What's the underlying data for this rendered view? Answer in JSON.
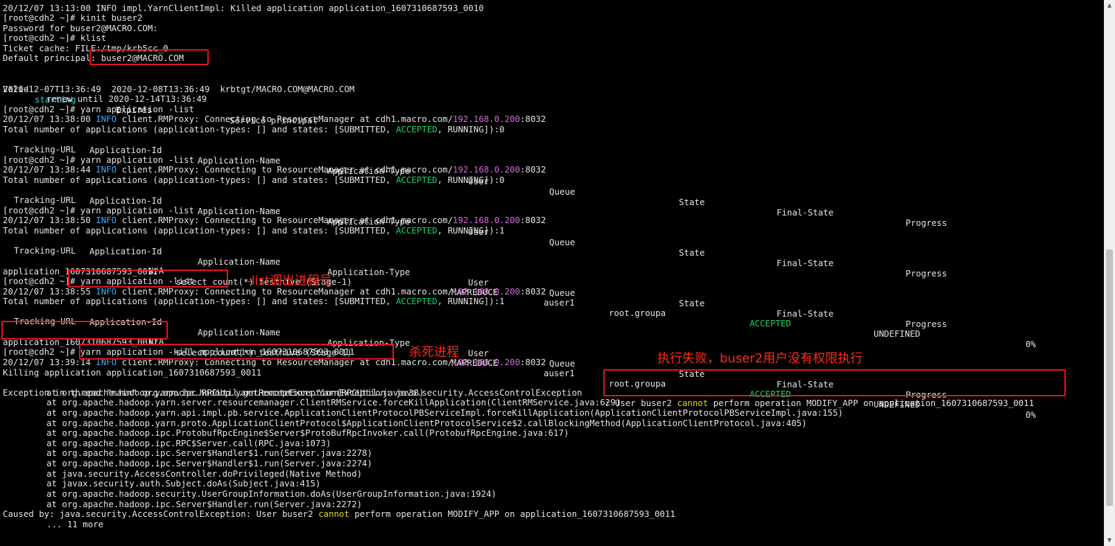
{
  "terminal": {
    "prompt": "[root@cdh2 ~]#",
    "kill_info_line": "20/12/07 13:13:00 INFO impl.YarnClientImpl: Killed application application_1607310687593_0010",
    "cmd_kinit": "kinit buser2",
    "password_prompt": "Password for buser2@MACRO.COM:",
    "cmd_klist": "klist",
    "ticket_cache": "Ticket cache: FILE:/tmp/krb5cc_0",
    "default_principal": "Default principal: buser2@MACRO.COM",
    "klist_header": {
      "valid": "Valid",
      "starting": "starting",
      "expires": "Expires",
      "service": "Service principal"
    },
    "ticket_row": "2020-12-07T13:36:49  2020-12-08T13:36:49  krbtgt/MACRO.COM@MACRO.COM",
    "renew_until": "renew until 2020-12-14T13:36:49",
    "cmd_list": "yarn application -list",
    "rmproxy": {
      "info": "INFO",
      "msg": "client.RMProxy: Connecting to ResourceManager at cdh1.macro.com/",
      "ip": "192.168.0.200",
      "port": ":8032",
      "times": [
        "20/12/07 13:38:00",
        "20/12/07 13:38:44",
        "20/12/07 13:38:50",
        "20/12/07 13:38:55",
        "20/12/07 13:39:14"
      ]
    },
    "total_apps": {
      "prefix": "Total number of applications (application-types: [] and states: [SUBMITTED,",
      "accepted": "ACCEPTED",
      "suffix_0": ", RUNNING]):0",
      "suffix_1": ", RUNNING]):1"
    },
    "columns": [
      "Application-Id",
      "Application-Name",
      "Application-Type",
      "User",
      "Queue",
      "State",
      "Final-State",
      "Progress",
      "Tracking-URL"
    ],
    "app_row": {
      "id": "application_1607310687593_0011",
      "name": "select count(*) testhive (Stage-1)",
      "type": "MAPREDUCE",
      "user": "auser1",
      "queue": "root.groupa",
      "state": "ACCEPTED",
      "final_state": "UNDEFINED",
      "progress": "0%",
      "tracking_url": "N/A"
    },
    "cmd_kill": "yarn application -kill application_1607310687593_0011",
    "killing": "Killing application application_1607310687593_0011",
    "exception_prefix": "Exception in thread \"main\" org.apache.hadoop.yarn.exceptions.YarnException: java.security.AccessControlException",
    "exception_tail": {
      "pre": ": User buser2 ",
      "cannot": "cannot",
      "post": " perform operation MODIFY_APP on application_1607310687593_0011"
    },
    "stack": [
      "at org.apache.hadoop.yarn.ipc.RPCUtil.getRemoteException(RPCUtil.java:38)",
      "at org.apache.hadoop.yarn.server.resourcemanager.ClientRMService.forceKillApplication(ClientRMService.java:629)",
      "at org.apache.hadoop.yarn.api.impl.pb.service.ApplicationClientProtocolPBServiceImpl.forceKillApplication(ApplicationClientProtocolPBServiceImpl.java:155)",
      "at org.apache.hadoop.yarn.proto.ApplicationClientProtocol$ApplicationClientProtocolService$2.callBlockingMethod(ApplicationClientProtocol.java:405)",
      "at org.apache.hadoop.ipc.ProtobufRpcEngine$Server$ProtoBufRpcInvoker.call(ProtobufRpcEngine.java:617)",
      "at org.apache.hadoop.ipc.RPC$Server.call(RPC.java:1073)",
      "at org.apache.hadoop.ipc.Server$Handler$1.run(Server.java:2278)",
      "at org.apache.hadoop.ipc.Server$Handler$1.run(Server.java:2274)",
      "at java.security.AccessController.doPrivileged(Native Method)",
      "at javax.security.auth.Subject.doAs(Subject.java:415)",
      "at org.apache.hadoop.security.UserGroupInformation.doAs(UserGroupInformation.java:1924)",
      "at org.apache.hadoop.ipc.Server$Handler.run(Server.java:2272)"
    ],
    "caused_by": {
      "pre": "Caused by: java.security.AccessControlException: User buser2 ",
      "cannot": "cannot",
      "post": " perform operation MODIFY_APP on application_1607310687593_0011"
    },
    "more": "... 11 more"
  },
  "annotations": {
    "list_note": "-list调出进程号",
    "kill_note": "杀死进程",
    "fail_note": "执行失败，buser2用户没有权限执行"
  },
  "colors": {
    "background": "#000000",
    "text": "#e6e6e6",
    "info": "#3fa9f5",
    "ip": "#d56bd6",
    "accepted": "#17d56a",
    "cannot": "#e9d81c",
    "highlight": "#e8141c",
    "annotation": "#ff2a1a"
  }
}
